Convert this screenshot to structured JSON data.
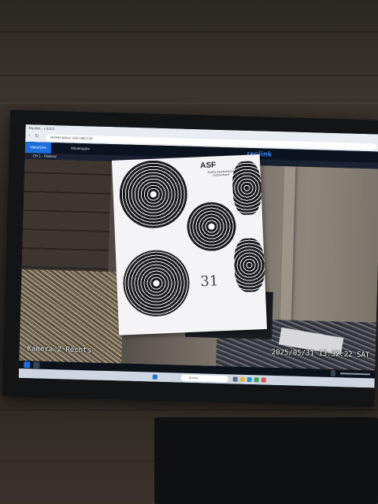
{
  "browser": {
    "tab_title": "Reolink - v 8.0.0",
    "address": "RHHH-fullscr 192.168.0.56"
  },
  "app": {
    "tabs": [
      {
        "label": "Video/Live",
        "active": true
      },
      {
        "label": "Wiedergabe",
        "active": false
      }
    ],
    "brand": "reolink",
    "brand_color": "#3d8cff",
    "channel_label": "CH 1 - Filelend"
  },
  "video": {
    "camera_name": "Kamera 2 Rechts",
    "timestamp": "2025/05/31 13:32:22 SAT",
    "target": {
      "logo": "ASF",
      "sub_text": "Austria Sportschützen Fachverband",
      "handwritten_number": "31"
    }
  },
  "taskbar": {
    "search_placeholder": "Suche"
  }
}
